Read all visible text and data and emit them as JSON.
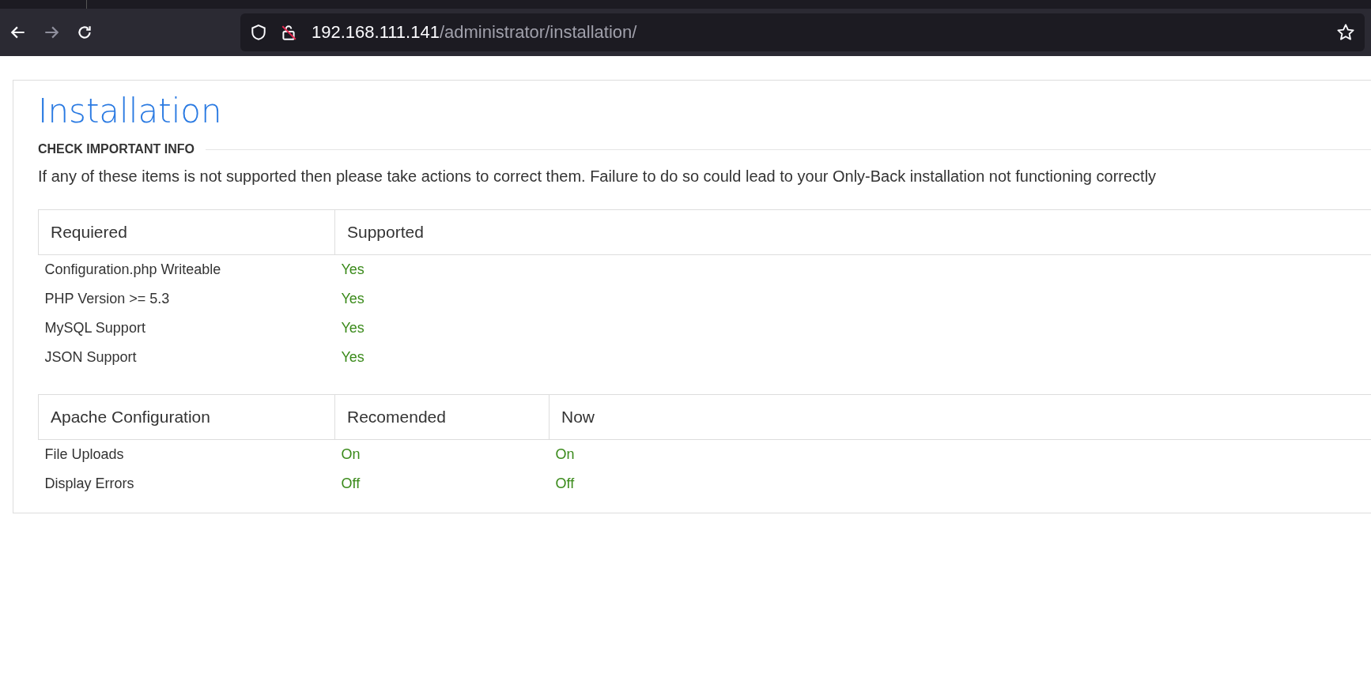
{
  "browser": {
    "url_host": "192.168.111.141",
    "url_path": "/administrator/installation/"
  },
  "page": {
    "title": "Installation",
    "section_heading": "CHECK IMPORTANT INFO",
    "notice": "If any of these items is not supported then please take actions to correct them. Failure to do so could lead to your Only-Back installation not functioning correctly"
  },
  "requirements_table": {
    "columns": [
      "Requiered",
      "Supported"
    ],
    "rows": [
      {
        "name": "Configuration.php Writeable",
        "supported": "Yes"
      },
      {
        "name": "PHP Version >= 5.3",
        "supported": "Yes"
      },
      {
        "name": "MySQL Support",
        "supported": "Yes"
      },
      {
        "name": "JSON Support",
        "supported": "Yes"
      }
    ]
  },
  "apache_table": {
    "columns": [
      "Apache Configuration",
      "Recomended",
      "Now"
    ],
    "rows": [
      {
        "name": "File Uploads",
        "recommended": "On",
        "now": "On"
      },
      {
        "name": "Display Errors",
        "recommended": "Off",
        "now": "Off"
      }
    ]
  }
}
